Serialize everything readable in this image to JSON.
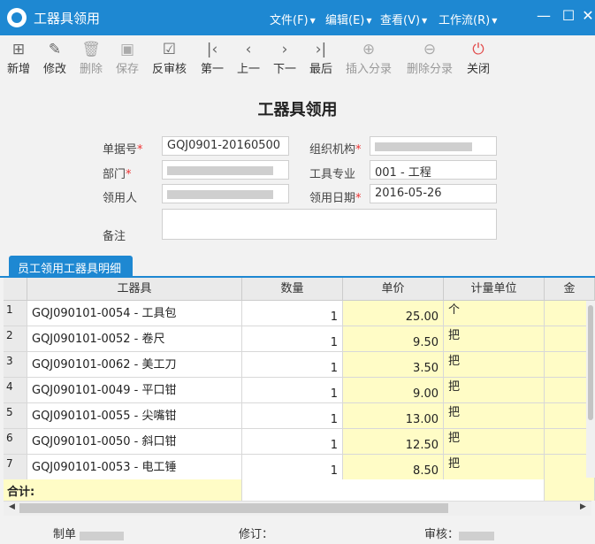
{
  "app": {
    "title": "工器具领用"
  },
  "menu": [
    {
      "label": "文件(F)"
    },
    {
      "label": "编辑(E)"
    },
    {
      "label": "查看(V)"
    },
    {
      "label": "工作流(R)"
    }
  ],
  "window_controls": {
    "minimize": "—",
    "maximize": "☐",
    "close": "✕"
  },
  "toolbar": [
    {
      "label": "新增",
      "icon": "new-doc-icon"
    },
    {
      "label": "修改",
      "icon": "edit-icon"
    },
    {
      "label": "删除",
      "icon": "delete-icon"
    },
    {
      "label": "保存",
      "icon": "save-icon"
    },
    {
      "label": "反审核",
      "icon": "unapprove-icon"
    },
    {
      "label": "第一",
      "icon": "first-icon"
    },
    {
      "label": "上一",
      "icon": "prev-icon"
    },
    {
      "label": "下一",
      "icon": "next-icon"
    },
    {
      "label": "最后",
      "icon": "last-icon"
    },
    {
      "label": "插入分录",
      "icon": "plus-circle-icon"
    },
    {
      "label": "删除分录",
      "icon": "minus-circle-icon"
    },
    {
      "label": "关闭",
      "icon": "power-icon"
    }
  ],
  "form": {
    "title": "工器具领用",
    "doc_no_label": "单据号",
    "doc_no_value": "GQJ0901-20160500",
    "org_label": "组织机构",
    "dept_label": "部门",
    "specialty_label": "工具专业",
    "specialty_value": "001 - 工程",
    "recipient_label": "领用人",
    "date_label": "领用日期",
    "date_value": "2016-05-26",
    "remark_label": "备注",
    "required_mark": "*"
  },
  "tab": {
    "label": "员工领用工器具明细"
  },
  "grid": {
    "headers": [
      "工器具",
      "数量",
      "单价",
      "计量单位",
      "金"
    ],
    "rows": [
      {
        "n": "1",
        "tool": "GQJ090101-0054 - 工具包",
        "qty": "1",
        "price": "25.00",
        "unit": "个"
      },
      {
        "n": "2",
        "tool": "GQJ090101-0052 - 卷尺",
        "qty": "1",
        "price": "9.50",
        "unit": "把"
      },
      {
        "n": "3",
        "tool": "GQJ090101-0062 - 美工刀",
        "qty": "1",
        "price": "3.50",
        "unit": "把"
      },
      {
        "n": "4",
        "tool": "GQJ090101-0049 - 平口钳",
        "qty": "1",
        "price": "9.00",
        "unit": "把"
      },
      {
        "n": "5",
        "tool": "GQJ090101-0055 - 尖嘴钳",
        "qty": "1",
        "price": "13.00",
        "unit": "把"
      },
      {
        "n": "6",
        "tool": "GQJ090101-0050 - 斜口钳",
        "qty": "1",
        "price": "12.50",
        "unit": "把"
      },
      {
        "n": "7",
        "tool": "GQJ090101-0053 - 电工锤",
        "qty": "1",
        "price": "8.50",
        "unit": "把"
      }
    ],
    "total_label": "合计:"
  },
  "footer": {
    "maker_label": "制单",
    "revise_label": "修订：",
    "audit_label": "审核："
  }
}
